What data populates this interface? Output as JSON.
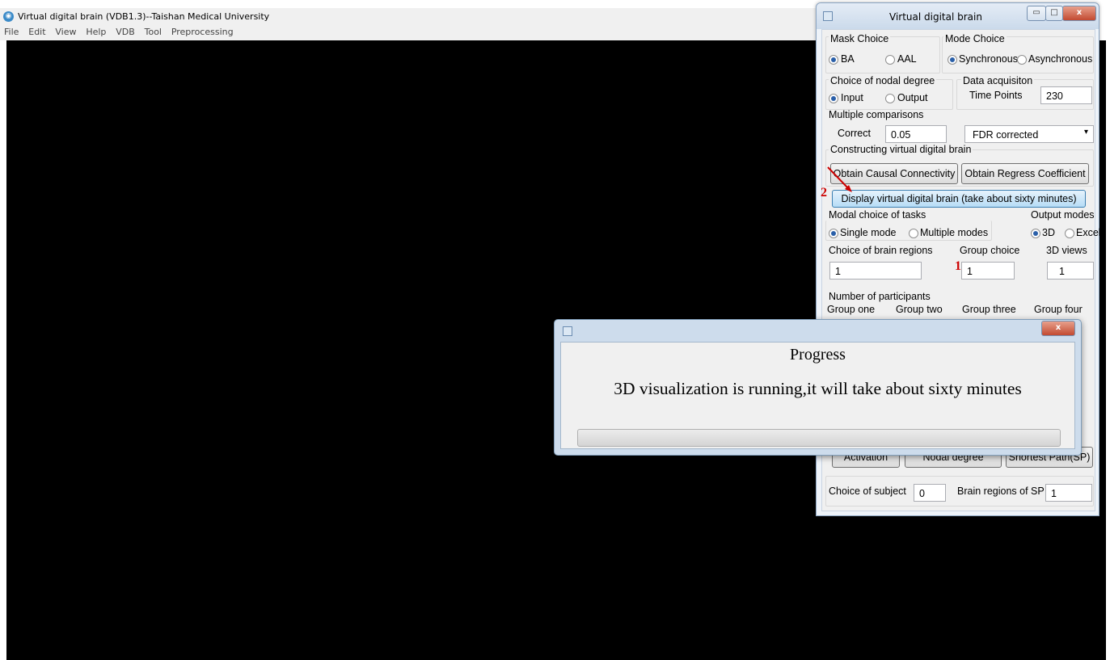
{
  "main_window": {
    "title": "Virtual digital brain (VDB1.3)--Taishan Medical University",
    "menu": [
      "File",
      "Edit",
      "View",
      "Help",
      "VDB",
      "Tool",
      "Preprocessing"
    ]
  },
  "panel": {
    "title": "Virtual  digital  brain",
    "mask_choice": {
      "label": "Mask Choice",
      "options": [
        "BA",
        "AAL"
      ],
      "selected": "BA"
    },
    "mode_choice": {
      "label": "Mode Choice",
      "options": [
        "Synchronous",
        "Asynchronous"
      ],
      "selected": "Synchronous"
    },
    "nodal_degree": {
      "label": "Choice of nodal degree",
      "options": [
        "Input",
        "Output"
      ],
      "selected": "Input"
    },
    "data_acquisition": {
      "label": "Data acquisiton",
      "time_points_label": "Time Points",
      "time_points_value": "230"
    },
    "multiple_comparisons": {
      "label": "Multiple comparisons",
      "correct_label": "Correct",
      "correct_value": "0.05",
      "method": "FDR corrected"
    },
    "constructing": {
      "label": "Constructing virtual digital brain",
      "obtain_causal": "Obtain  Causal Connectivity",
      "obtain_regress": "Obtain Regress Coefficient",
      "display": "Display virtual digital brain (take about sixty minutes)"
    },
    "modal_choice": {
      "label": "Modal choice of tasks",
      "options": [
        "Single mode",
        "Multiple modes"
      ],
      "selected": "Single mode"
    },
    "output_modes": {
      "label": "Output modes",
      "options": [
        "3D",
        "Excel"
      ],
      "selected": "3D"
    },
    "brain_regions": {
      "label": "Choice of brain regions",
      "value": "1"
    },
    "group_choice": {
      "label": "Group choice",
      "value": "1"
    },
    "views_3d": {
      "label": "3D views",
      "value": "1"
    },
    "participants": {
      "label": "Number of participants",
      "groups": [
        "Group one",
        "Group two",
        "Group three",
        "Group four"
      ]
    },
    "analysis_buttons": [
      "Activation",
      "Nodal degree",
      "Shortest Path(SP)"
    ],
    "subject": {
      "label": "Choice of subject",
      "value": "0"
    },
    "sp_regions": {
      "label": "Brain regions of SP",
      "value": "1"
    },
    "annotations": {
      "marker_1": "1",
      "marker_2": "2"
    }
  },
  "dialog": {
    "heading": "Progress",
    "message": "3D visualization is running,it will take about sixty minutes",
    "progress_fraction": 0.0
  }
}
